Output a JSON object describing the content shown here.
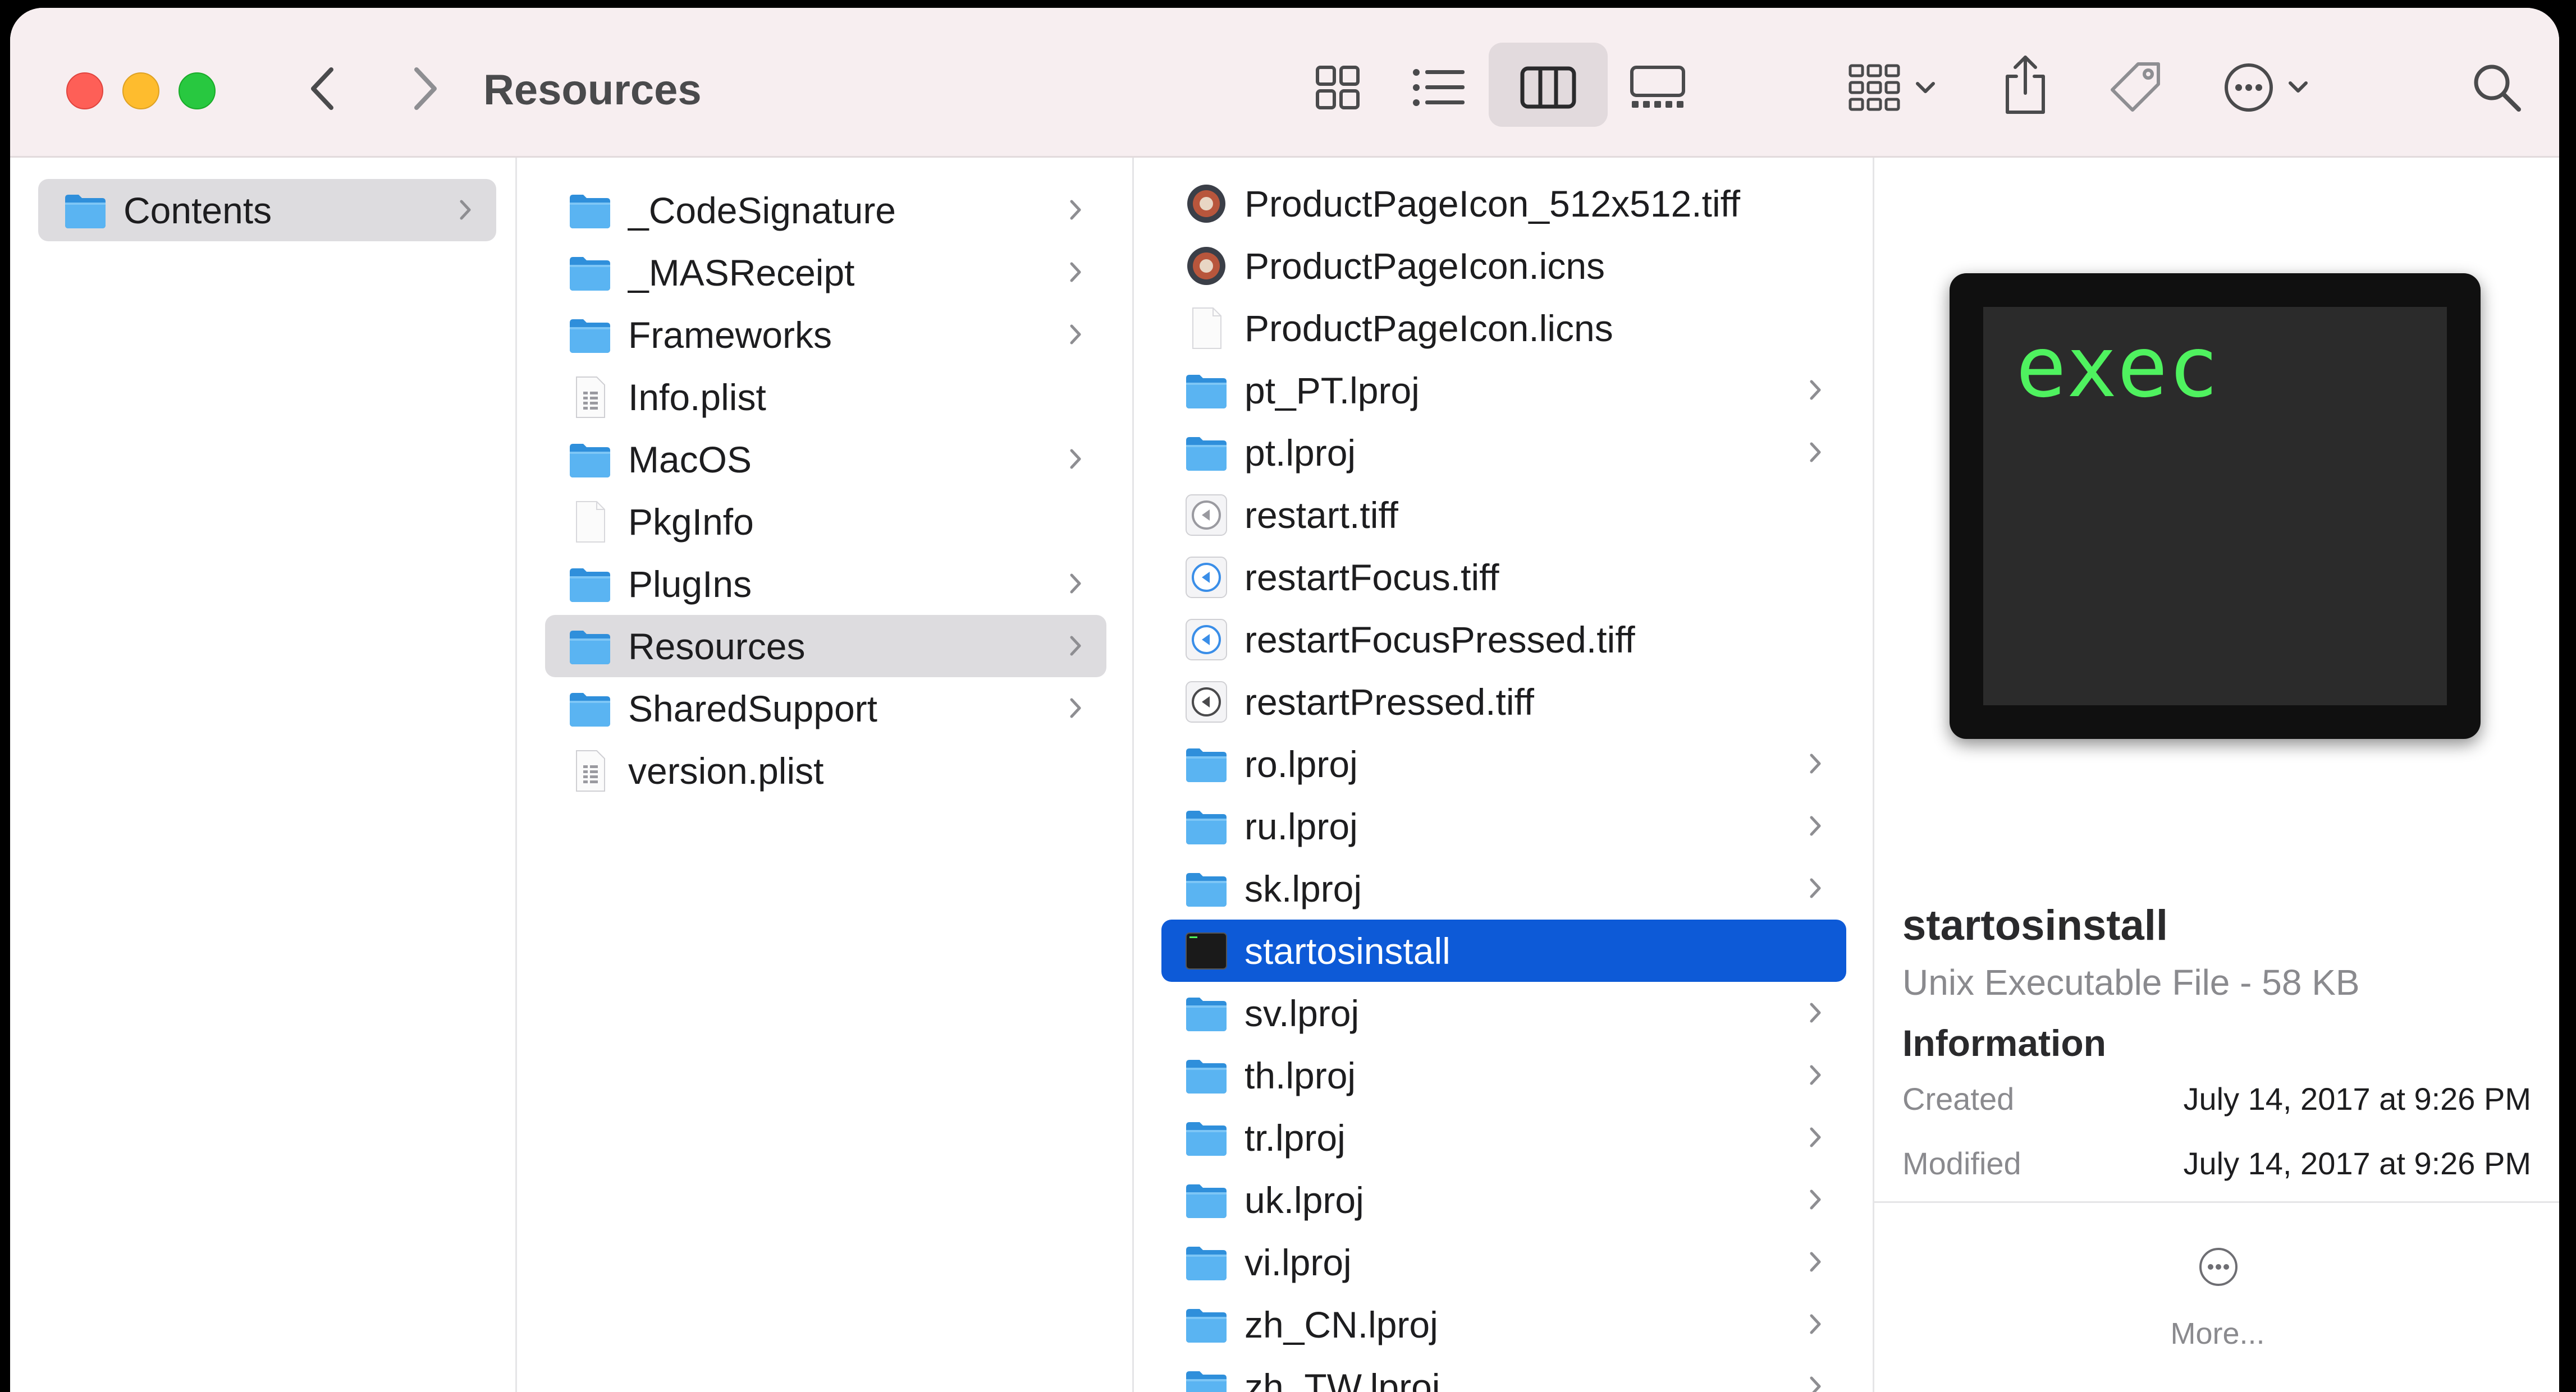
{
  "window": {
    "title": "Resources"
  },
  "toolbar": {
    "back_icon": "chevron-left-icon",
    "forward_icon": "chevron-right-icon",
    "views": [
      "icon-view-icon",
      "list-view-icon",
      "column-view-icon",
      "gallery-view-icon"
    ],
    "active_view": "column-view-icon",
    "group_icon": "group-icon",
    "share_icon": "share-icon",
    "tag_icon": "tag-icon",
    "action_icon": "ellipsis-circle-icon",
    "search_icon": "search-icon"
  },
  "column1": [
    {
      "label": "Contents",
      "type": "folder",
      "has_children": true,
      "selected": "grey"
    }
  ],
  "column2": [
    {
      "label": "_CodeSignature",
      "type": "folder",
      "has_children": true
    },
    {
      "label": "_MASReceipt",
      "type": "folder",
      "has_children": true
    },
    {
      "label": "Frameworks",
      "type": "folder",
      "has_children": true
    },
    {
      "label": "Info.plist",
      "type": "plist",
      "has_children": false
    },
    {
      "label": "MacOS",
      "type": "folder",
      "has_children": true
    },
    {
      "label": "PkgInfo",
      "type": "doc",
      "has_children": false
    },
    {
      "label": "PlugIns",
      "type": "folder",
      "has_children": true
    },
    {
      "label": "Resources",
      "type": "folder",
      "has_children": true,
      "selected": "grey"
    },
    {
      "label": "SharedSupport",
      "type": "folder",
      "has_children": true
    },
    {
      "label": "version.plist",
      "type": "plist",
      "has_children": false
    }
  ],
  "column3": [
    {
      "label": "ProductPageIcon_512x512.tiff",
      "type": "app-image",
      "has_children": false
    },
    {
      "label": "ProductPageIcon.icns",
      "type": "app-image",
      "has_children": false
    },
    {
      "label": "ProductPageIcon.licns",
      "type": "doc",
      "has_children": false
    },
    {
      "label": "pt_PT.lproj",
      "type": "folder",
      "has_children": true
    },
    {
      "label": "pt.lproj",
      "type": "folder",
      "has_children": true
    },
    {
      "label": "restart.tiff",
      "type": "restart-grey",
      "has_children": false
    },
    {
      "label": "restartFocus.tiff",
      "type": "restart-blue",
      "has_children": false
    },
    {
      "label": "restartFocusPressed.tiff",
      "type": "restart-blue",
      "has_children": false
    },
    {
      "label": "restartPressed.tiff",
      "type": "restart-dark",
      "has_children": false
    },
    {
      "label": "ro.lproj",
      "type": "folder",
      "has_children": true
    },
    {
      "label": "ru.lproj",
      "type": "folder",
      "has_children": true
    },
    {
      "label": "sk.lproj",
      "type": "folder",
      "has_children": true
    },
    {
      "label": "startosinstall",
      "type": "exec",
      "has_children": false,
      "selected": "blue"
    },
    {
      "label": "sv.lproj",
      "type": "folder",
      "has_children": true
    },
    {
      "label": "th.lproj",
      "type": "folder",
      "has_children": true
    },
    {
      "label": "tr.lproj",
      "type": "folder",
      "has_children": true
    },
    {
      "label": "uk.lproj",
      "type": "folder",
      "has_children": true
    },
    {
      "label": "vi.lproj",
      "type": "folder",
      "has_children": true
    },
    {
      "label": "zh_CN.lproj",
      "type": "folder",
      "has_children": true
    },
    {
      "label": "zh_TW.lproj",
      "type": "folder",
      "has_children": true
    }
  ],
  "preview": {
    "thumbnail_text": "exec",
    "name": "startosinstall",
    "kind": "Unix Executable File - 58 KB",
    "section_title": "Information",
    "info": [
      {
        "key": "Created",
        "value": "July 14, 2017 at 9:26 PM"
      },
      {
        "key": "Modified",
        "value": "July 14, 2017 at 9:26 PM"
      }
    ],
    "more_label": "More..."
  },
  "colors": {
    "toolbar_bg": "#f7eef0",
    "selection_blue": "#0d5ad7",
    "selection_grey": "#dddcdf",
    "folder_blue": "#46a7ee",
    "exec_green": "#4ff25f"
  }
}
